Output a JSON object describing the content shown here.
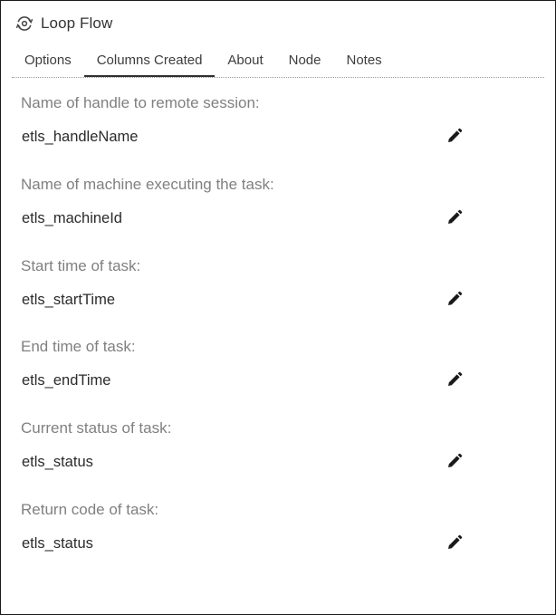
{
  "window": {
    "title": "Loop Flow",
    "icon": "loop-flow-icon"
  },
  "tabs": [
    {
      "label": "Options",
      "active": false
    },
    {
      "label": "Columns Created",
      "active": true
    },
    {
      "label": "About",
      "active": false
    },
    {
      "label": "Node",
      "active": false
    },
    {
      "label": "Notes",
      "active": false
    }
  ],
  "fields": [
    {
      "label": "Name of handle to remote session:",
      "value": "etls_handleName"
    },
    {
      "label": "Name of machine executing the task:",
      "value": "etls_machineId"
    },
    {
      "label": "Start time of task:",
      "value": "etls_startTime"
    },
    {
      "label": "End time of task:",
      "value": "etls_endTime"
    },
    {
      "label": "Current status of task:",
      "value": "etls_status"
    },
    {
      "label": "Return code of task:",
      "value": "etls_status"
    }
  ],
  "icons": {
    "edit": "pencil-icon"
  },
  "colors": {
    "label": "#808080",
    "value": "#2b2b2b",
    "border": "#1a1a1a"
  }
}
